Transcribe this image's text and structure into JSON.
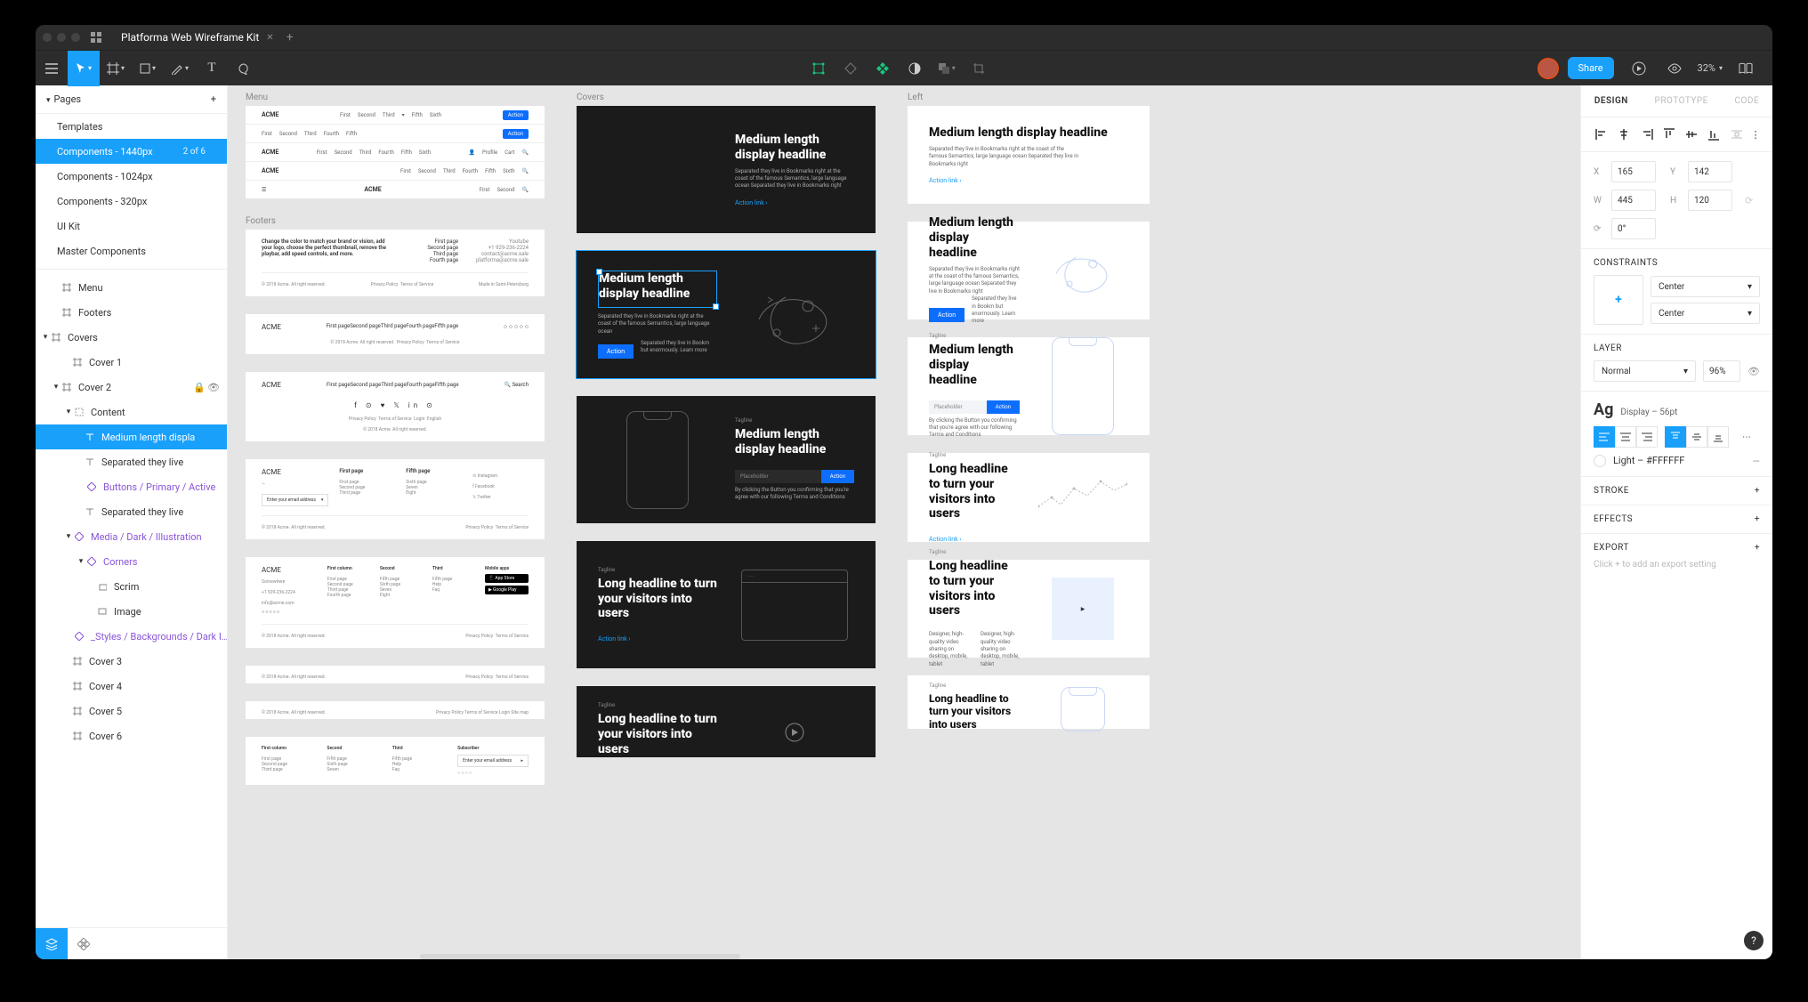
{
  "title": "Platforma Web Wireframe Kit",
  "zoom": "32%",
  "rtabs": {
    "design": "DESIGN",
    "prototype": "PROTOTYPE",
    "code": "CODE"
  },
  "pagesHeader": "Pages",
  "pages": {
    "templates": "Templates",
    "c1440": "Components - 1440px",
    "c1440badge": "2 of 6",
    "c1024": "Components - 1024px",
    "c320": "Components - 320px",
    "uikit": "UI Kit",
    "master": "Master Components"
  },
  "layers": {
    "menu": "Menu",
    "footers": "Footers",
    "covers": "Covers",
    "cover1": "Cover 1",
    "cover2": "Cover 2",
    "content": "Content",
    "headline": "Medium length displa",
    "sep1": "Separated they live",
    "buttons": "Buttons / Primary / Active",
    "sep2": "Separated they live",
    "media": "Media / Dark / Illustration",
    "corners": "Corners",
    "scrim": "Scrim",
    "image": "Image",
    "styles": "_Styles / Backgrounds / Dark I…",
    "cover3": "Cover 3",
    "cover4": "Cover 4",
    "cover5": "Cover 5",
    "cover6": "Cover 6"
  },
  "canvas": {
    "menus": "Menu",
    "footers": "Footers",
    "covers": "Covers",
    "left": "Left",
    "brand": "ACME",
    "nav": {
      "first": "First",
      "second": "Second",
      "third": "Third",
      "fourth": "Fourth",
      "fifth": "Fifth",
      "sixth": "Sixth"
    },
    "action": "Action",
    "profile": "Profile",
    "cart": "Cart",
    "search": "Search",
    "footerText": "Change the color to match your brand or vision, add your logo, choose the perfect thumbnail, remove the playbar, add speed controls, and more.",
    "firstpage": "First page",
    "secondpage": "Second page",
    "thirdpage": "Third page",
    "fourthpage": "Fourth page",
    "fifthpage": "Fifth page",
    "sixthpage": "Sixth page",
    "copyright": "© 2018 Acme. All right reserved.",
    "privacy": "Privacy Policy",
    "terms": "Terms of Service",
    "made": "Made in Saint-Petersburg",
    "subscribe": "Subscribe",
    "email": "Enter your email address",
    "firstcol": "First column",
    "second2": "Second",
    "third2": "Third",
    "mobile": "Mobile apps",
    "subscriber": "Subscriber",
    "login": "Login",
    "english": "English",
    "addr": "Somewhere",
    "instagram": "Instagram",
    "facebook": "Facebook",
    "twitter": "Twitter",
    "headline": "Medium length display headline",
    "sub": "Separated they live in Bookmarks right at the coast of the famous Semantics, large language ocean Separated they live in Bookmarks right",
    "subshort": "Separated they live in Bookmarks right at the coast of the famous Semantics, large language ocean",
    "actionlink": "Action link",
    "tagline": "Tagline",
    "longhl": "Long headline to turn your visitors into users",
    "placeholder": "Placeholder",
    "disclaimer": "By clicking the Button you confirming that you're agree with our following Terms and Conditions",
    "disclaimer2": "Separated they live in Bookm but enormously. Learn more",
    "design1": "Designer, high-quality video sharing on desktop, mobile, tablet",
    "design2": "Designer, high-quality video sharing on desktop, mobile, tablet"
  },
  "props": {
    "x": "165",
    "y": "142",
    "w": "445",
    "h": "120",
    "rot": "0°",
    "constraints": "CONSTRAINTS",
    "center": "Center",
    "layer": "LAYER",
    "blend": "Normal",
    "opacity": "96%",
    "typestyle": "Display – 56pt",
    "ag": "Ag",
    "color": "Light – #FFFFFF",
    "stroke": "STROKE",
    "effects": "EFFECTS",
    "export": "EXPORT",
    "exporthint": "Click + to add an export setting"
  },
  "share": "Share"
}
